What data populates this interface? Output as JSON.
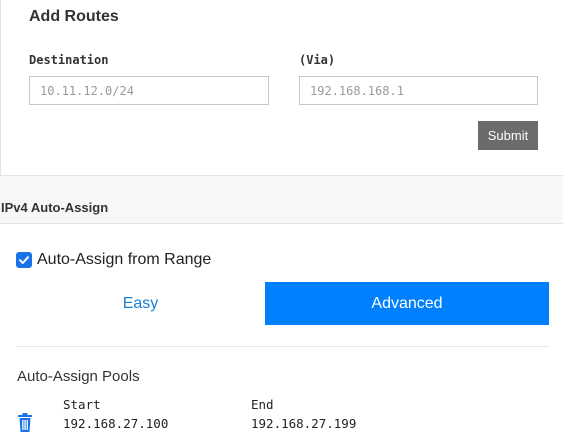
{
  "routes": {
    "title": "Add Routes",
    "destination": {
      "label": "Destination",
      "placeholder": "10.11.12.0/24",
      "value": ""
    },
    "via": {
      "label": "(Via)",
      "placeholder": "192.168.168.1",
      "value": ""
    },
    "submit_label": "Submit"
  },
  "ipv4": {
    "title": "IPv4 Auto-Assign",
    "auto_assign_label": "Auto-Assign from Range",
    "auto_assign_checked": true,
    "tabs": [
      {
        "label": "Easy",
        "active": false
      },
      {
        "label": "Advanced",
        "active": true
      }
    ],
    "pools_title": "Auto-Assign Pools",
    "pools_columns": [
      "Start",
      "End"
    ],
    "pools": [
      {
        "start": "192.168.27.100",
        "end": "192.168.27.199"
      }
    ]
  },
  "colors": {
    "accent": "#0080ff",
    "link": "#1a7fd6",
    "submit": "#6b6b6b",
    "checkbox": "#1a73e8"
  },
  "icons": [
    "check-icon",
    "trash-icon"
  ]
}
